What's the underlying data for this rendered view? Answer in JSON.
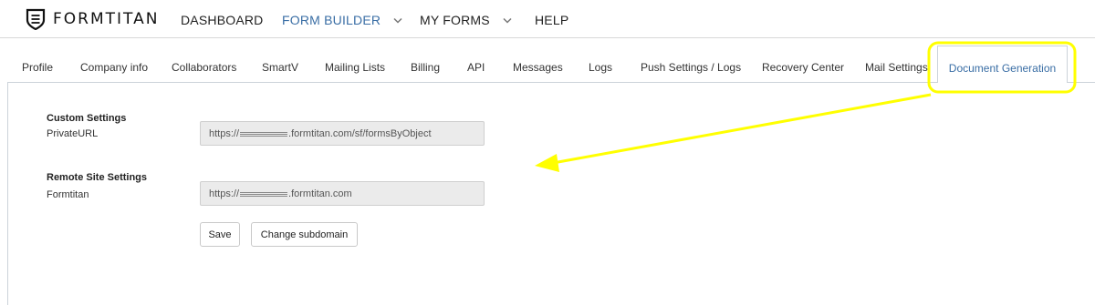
{
  "header": {
    "brand": "FORMTITAN",
    "nav": [
      {
        "label": "DASHBOARD",
        "dropdown": false,
        "active": false
      },
      {
        "label": "FORM BUILDER",
        "dropdown": true,
        "active": true
      },
      {
        "label": "MY FORMS",
        "dropdown": true,
        "active": false
      },
      {
        "label": "HELP",
        "dropdown": false,
        "active": false
      }
    ]
  },
  "tabs": [
    "Profile",
    "Company info",
    "Collaborators",
    "SmartV",
    "Mailing Lists",
    "Billing",
    "API",
    "Messages",
    "Logs",
    "Push Settings / Logs",
    "Recovery Center",
    "Mail Settings"
  ],
  "active_tab": "Document Generation",
  "custom_settings": {
    "title": "Custom Settings",
    "label": "PrivateURL",
    "value_prefix": "https://",
    "value_suffix": ".formtitan.com/sf/formsByObject"
  },
  "remote_site_settings": {
    "title": "Remote Site Settings",
    "label": "Formtitan",
    "value_prefix": "https://",
    "value_suffix": ".formtitan.com"
  },
  "buttons": {
    "save": "Save",
    "change_subdomain": "Change subdomain"
  },
  "colors": {
    "accent": "#3a6ea5",
    "highlight": "#ffff00"
  }
}
